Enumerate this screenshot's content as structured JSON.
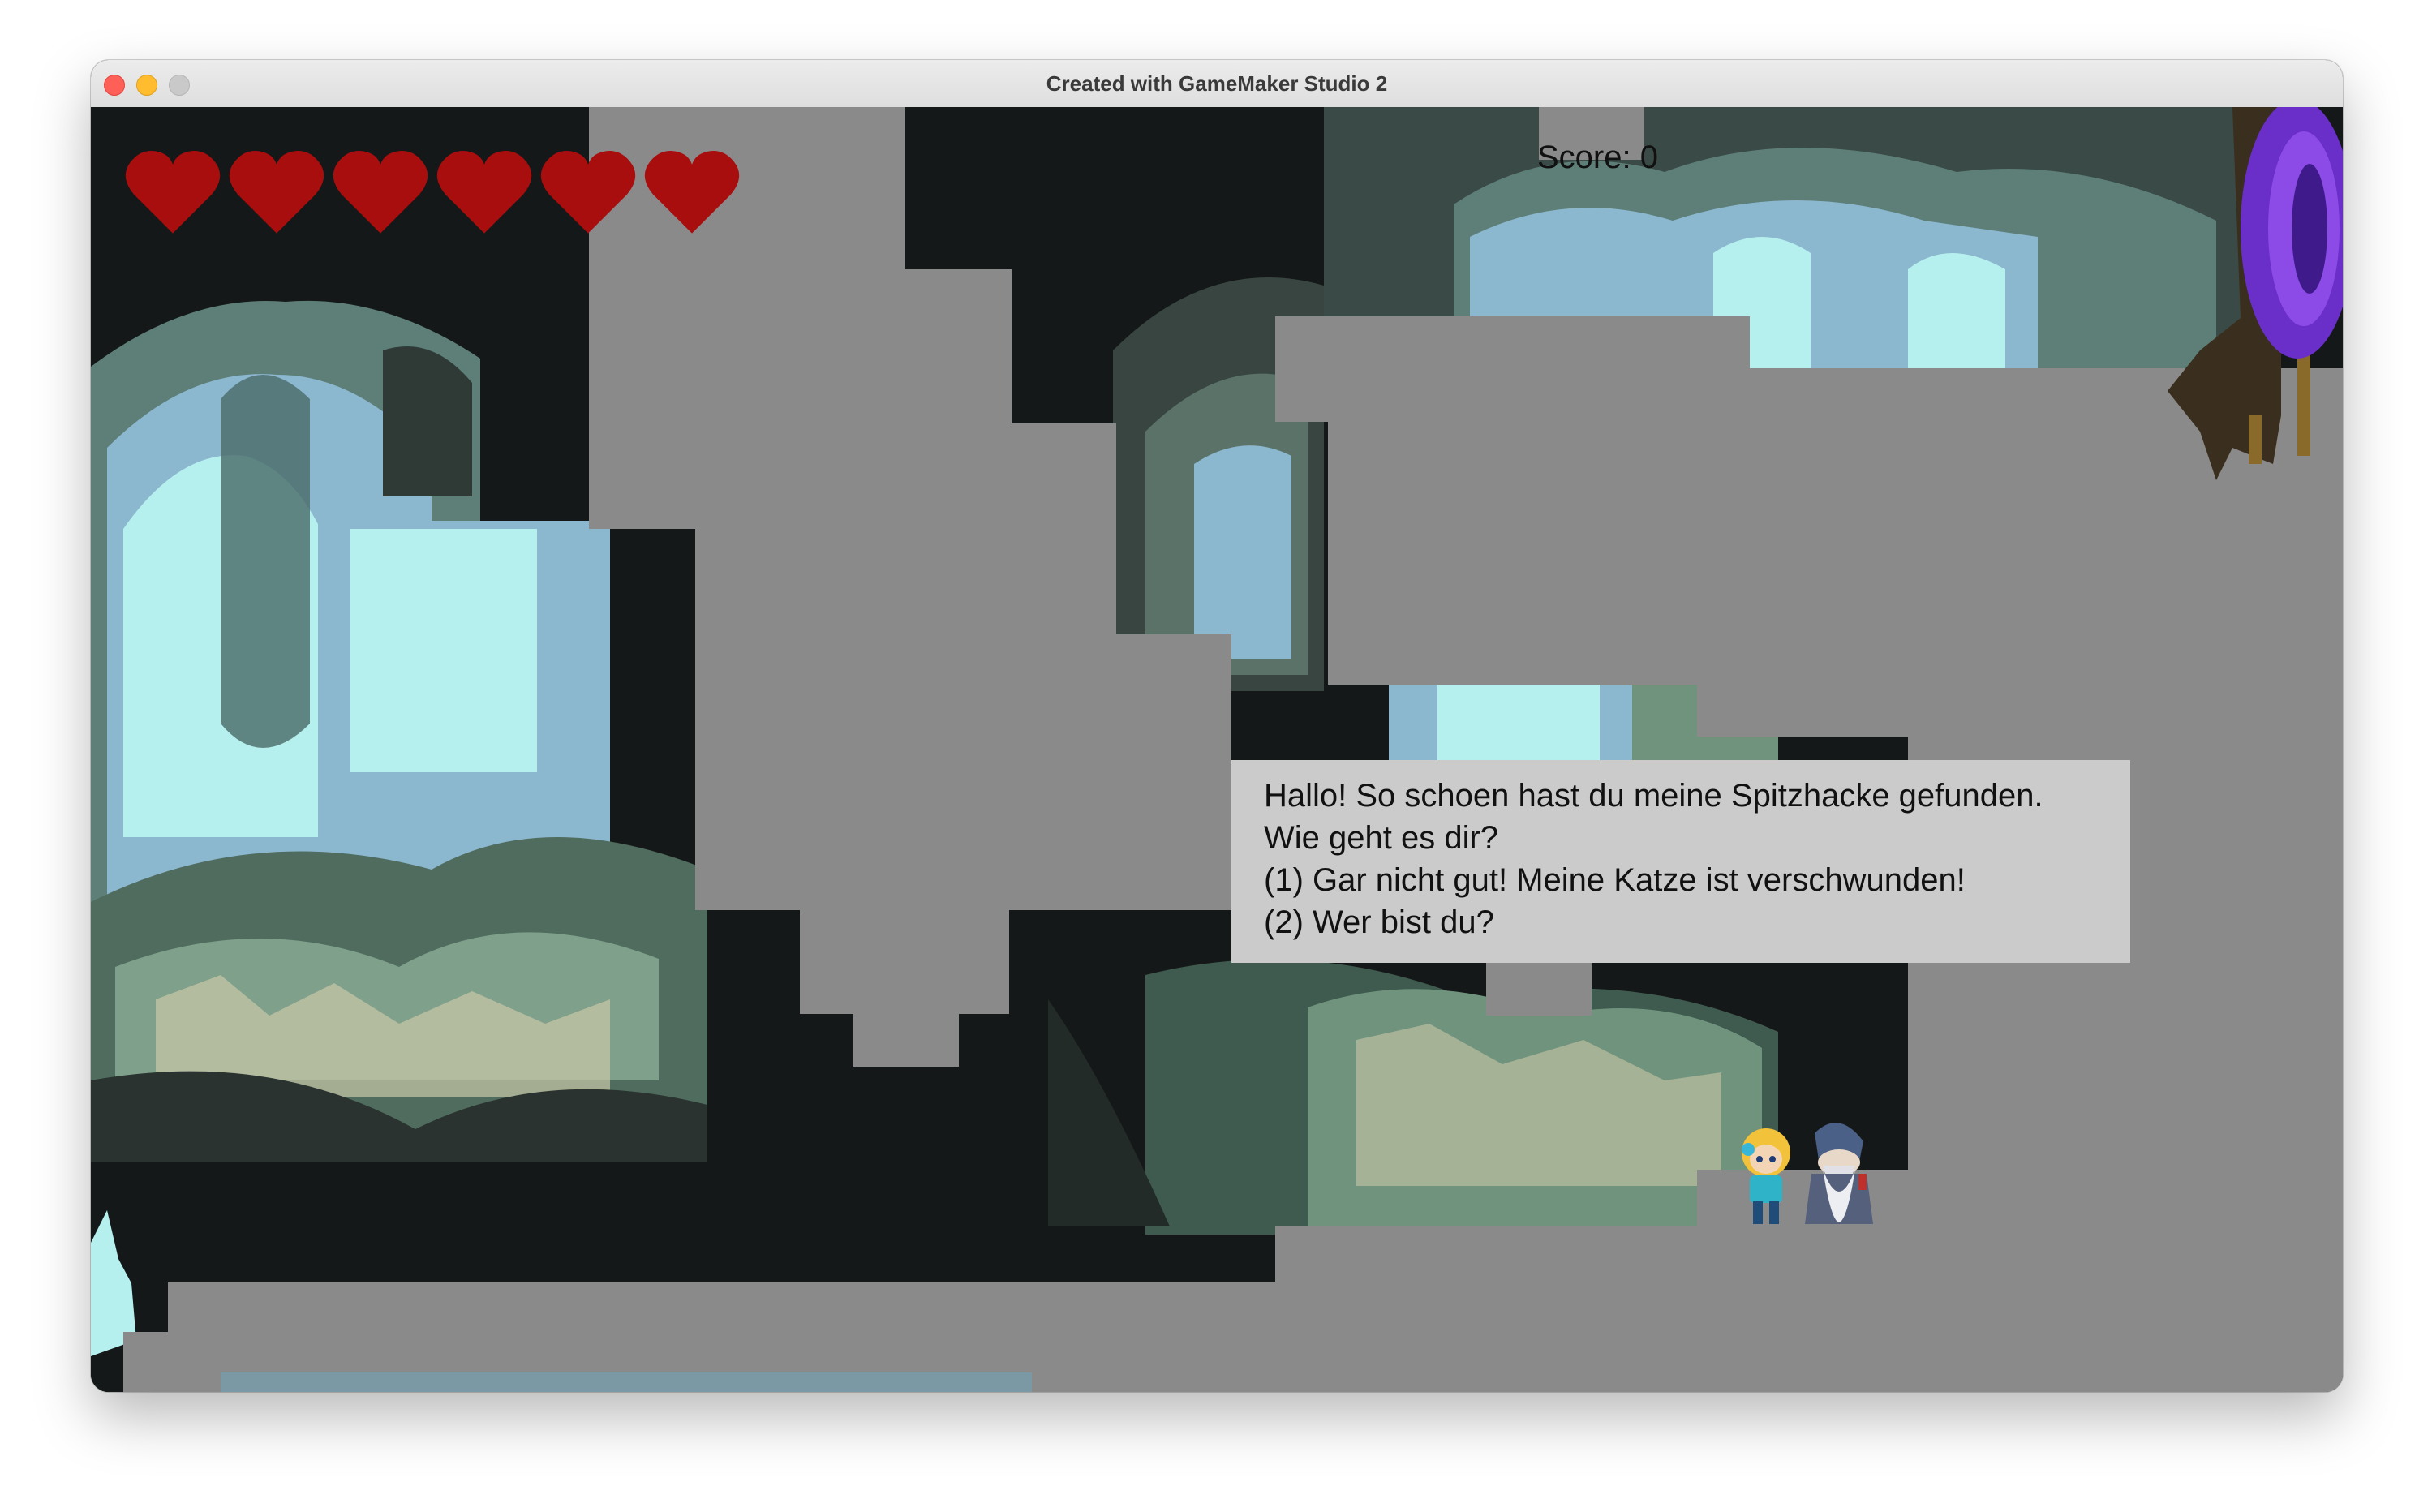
{
  "window": {
    "title": "Created with GameMaker Studio 2"
  },
  "hud": {
    "hearts": 6,
    "score_text": "Score: 0",
    "heart_color": "#a80e0e"
  },
  "dialog": {
    "lines": [
      "Hallo! So schoen hast du meine Spitzhacke gefunden.",
      "Wie geht es dir?",
      "(1) Gar nicht gut! Meine Katze ist verschwunden!",
      "(2) Wer bist du?"
    ]
  },
  "colors": {
    "placeholder_gray": "#8a8a8a",
    "cave_dark": "#151818",
    "ice_light": "#b6f0ee",
    "portal_purple": "#6a2fc8"
  },
  "icons": [
    "heart-icon",
    "portal-icon",
    "player-sprite",
    "gnome-npc-sprite"
  ]
}
